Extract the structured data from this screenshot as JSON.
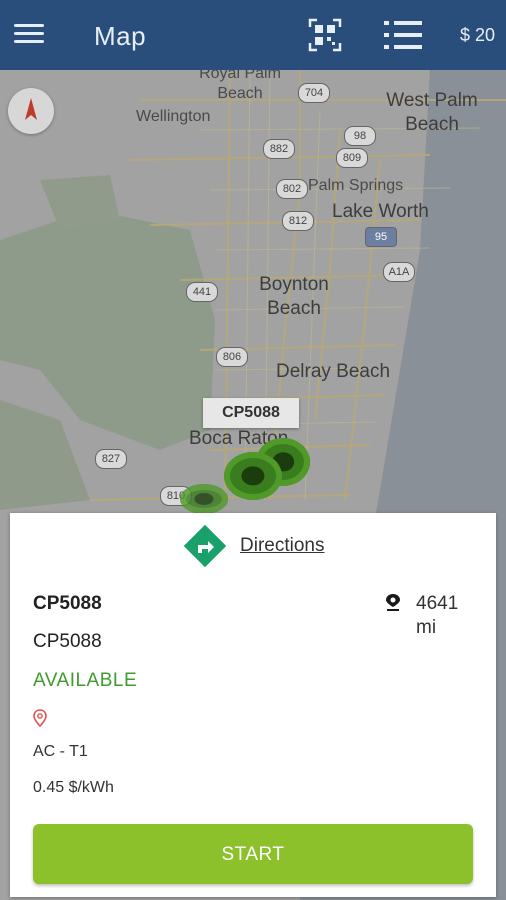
{
  "appbar": {
    "title": "Map",
    "balance": "$ 20",
    "icons": [
      "menu-icon",
      "qr-scan-icon",
      "list-icon"
    ],
    "color": "#2a4e7c"
  },
  "map": {
    "labels": {
      "royal_palm_beach": "Royal Palm\nBeach",
      "wellington": "Wellington",
      "west_palm_beach": "West Palm\nBeach",
      "palm_springs": "Palm Springs",
      "lake_worth": "Lake Worth",
      "boynton_beach": "Boynton\nBeach",
      "delray_beach": "Delray Beach",
      "boca_raton": "Boca Raton"
    },
    "shields": {
      "r704": "704",
      "r98": "98",
      "r882": "882",
      "r809": "809",
      "r802": "802",
      "r812": "812",
      "r95": "95",
      "r441": "441",
      "a1a": "A1A",
      "r806": "806",
      "r827": "827",
      "r810": "810"
    },
    "selected_marker": "CP5088",
    "marker_color": "#3a7d1e"
  },
  "card": {
    "directions_label": "Directions",
    "station_name": "CP5088",
    "station_id": "CP5088",
    "status": "AVAILABLE",
    "connector": "AC - T1",
    "price": "0.45 $/kWh",
    "distance_value": "4641",
    "distance_unit": "mi",
    "start_label": "START",
    "status_color": "#3f9b2e",
    "button_color": "#8dc12c",
    "directions_icon_color": "#1aa06a"
  }
}
